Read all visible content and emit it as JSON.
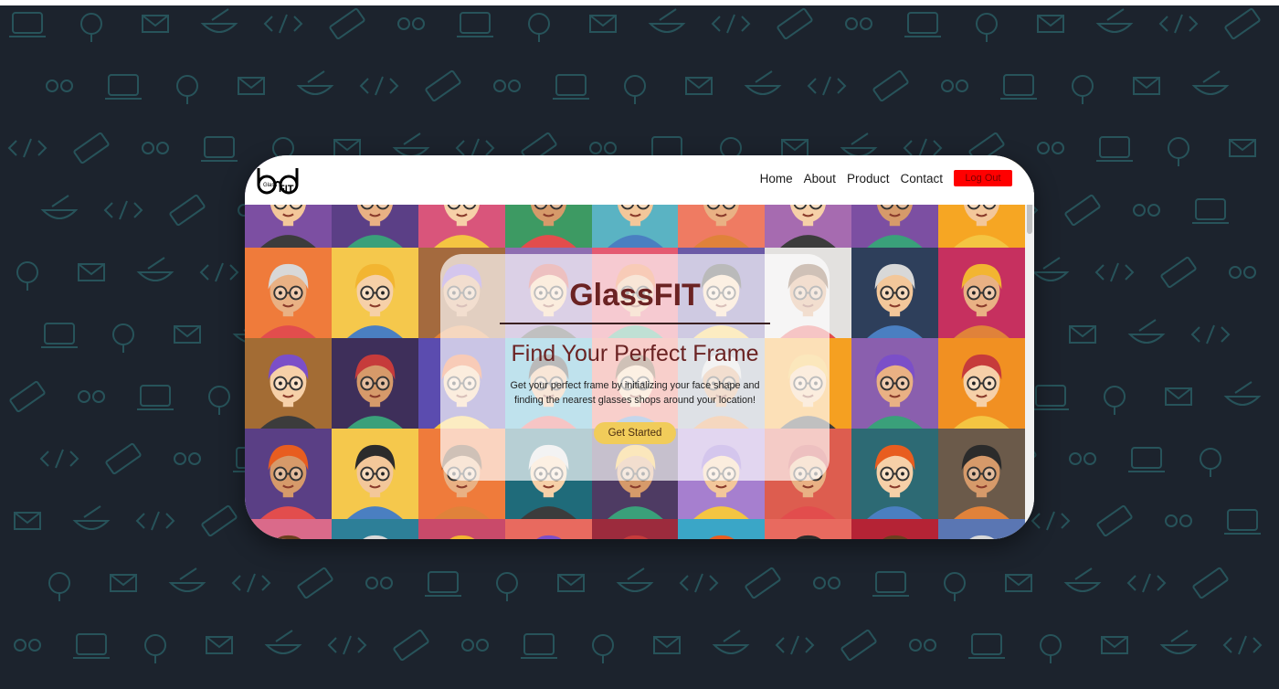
{
  "nav": {
    "links": [
      "Home",
      "About",
      "Product",
      "Contact"
    ],
    "logout_label": "Log Out"
  },
  "logo": {
    "icon": "glassfit-logo-icon",
    "text": "Glass"
  },
  "hero": {
    "title": "GlassFIT",
    "subtitle": "Find Your Perfect Frame",
    "text": "Get your perfect frame by initializing your face shape and finding the nearest glasses shops around your location!",
    "cta_label": "Get Started"
  },
  "colors": {
    "background": "#1c232d",
    "accent_red": "#ff0000",
    "hero_title": "#6b2323",
    "cta": "#f1cc5a"
  },
  "tiles": [
    "#7c4fa2",
    "#5b3f86",
    "#d9557b",
    "#3d9a63",
    "#5ab3c3",
    "#ef7b62",
    "#a66bb0",
    "#7c4fa2",
    "#f6a623",
    "#ef7b3b",
    "#f5c84c",
    "#a46a3e",
    "#8e6db1",
    "#e45a71",
    "#6b5aa6",
    "#e3e1df",
    "#2e3f5b",
    "#c6305f",
    "#a36c34",
    "#3e2f5a",
    "#5b4caf",
    "#3aa6c7",
    "#e86a5f",
    "#9aa3b1",
    "#f5a021",
    "#8a5fae",
    "#f19022",
    "#5a3f85",
    "#f5c84c",
    "#ef7b3b",
    "#1f6b7a",
    "#4e3b63",
    "#a67fcf",
    "#dd5d4f",
    "#2d6a74",
    "#6b5a4a",
    "#da6a8a",
    "#2d7f98",
    "#c94a6a",
    "#e86a5f",
    "#9c2b3d",
    "#3aa6c7",
    "#e86a5f",
    "#b52335",
    "#5a76b3"
  ]
}
